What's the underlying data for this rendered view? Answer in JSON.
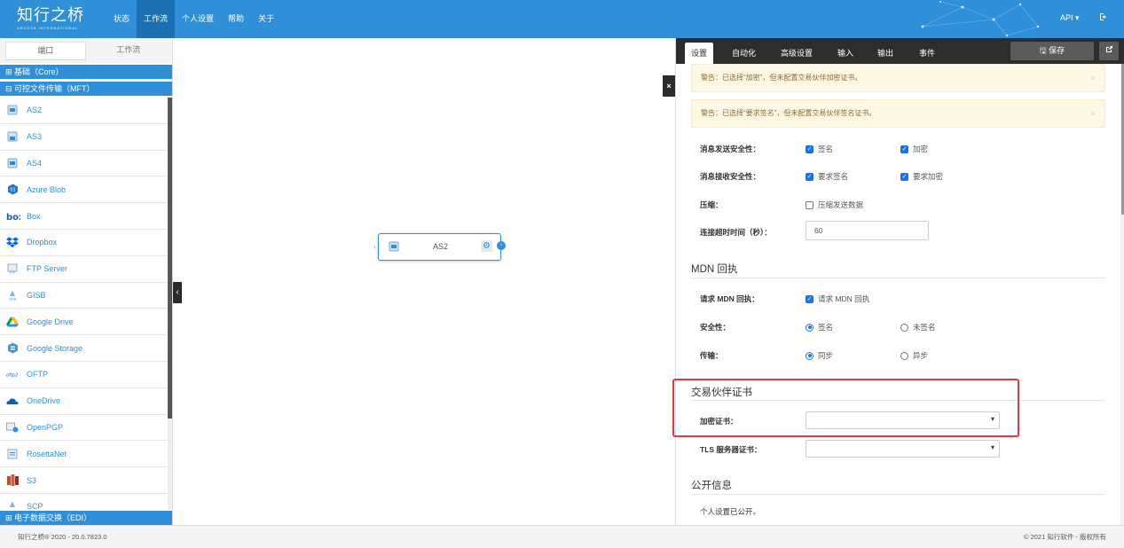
{
  "brand": {
    "name": "知行之桥",
    "subtitle": "ARCESB INTERNATIONAL"
  },
  "nav": {
    "items": [
      "状态",
      "工作流",
      "个人设置",
      "帮助",
      "关于"
    ],
    "active": "工作流",
    "api_label": "API ▾"
  },
  "sidebar": {
    "tabs": [
      "端口",
      "工作流"
    ],
    "active_tab": "端口",
    "categories": {
      "core": "⊞ 基础（Core）",
      "mft": "⊟ 可控文件传输（MFT）",
      "edi": "⊞ 电子数据交换（EDI）"
    },
    "connectors": [
      {
        "label": "AS2",
        "icon": "as2-icon"
      },
      {
        "label": "AS3",
        "icon": "as3-icon"
      },
      {
        "label": "AS4",
        "icon": "as4-icon"
      },
      {
        "label": "Azure Blob",
        "icon": "azure-blob-icon"
      },
      {
        "label": "Box",
        "icon": "box-icon"
      },
      {
        "label": "Dropbox",
        "icon": "dropbox-icon"
      },
      {
        "label": "FTP Server",
        "icon": "ftp-server-icon"
      },
      {
        "label": "GISB",
        "icon": "gisb-icon"
      },
      {
        "label": "Google Drive",
        "icon": "google-drive-icon"
      },
      {
        "label": "Google Storage",
        "icon": "google-storage-icon"
      },
      {
        "label": "OFTP",
        "icon": "oftp-icon"
      },
      {
        "label": "OneDrive",
        "icon": "onedrive-icon"
      },
      {
        "label": "OpenPGP",
        "icon": "openpgp-icon"
      },
      {
        "label": "RosettaNet",
        "icon": "rosettanet-icon"
      },
      {
        "label": "S3",
        "icon": "s3-icon"
      },
      {
        "label": "SCP",
        "icon": "scp-icon"
      }
    ]
  },
  "canvas": {
    "node_label": "AS2"
  },
  "panel": {
    "tabs": [
      "设置",
      "自动化",
      "高级设置",
      "输入",
      "输出",
      "事件"
    ],
    "active_tab": "设置",
    "save_label": "🖫 保存",
    "alerts": [
      "警告：已选择“加密”，但未配置交易伙伴加密证书。",
      "警告：已选择“要求签名”，但未配置交易伙伴签名证书。"
    ],
    "alert_close": "×",
    "send_security": {
      "label": "消息发送安全性：",
      "options": [
        {
          "text": "签名",
          "checked": true
        },
        {
          "text": "加密",
          "checked": true
        }
      ]
    },
    "receive_security": {
      "label": "消息接收安全性：",
      "options": [
        {
          "text": "要求签名",
          "checked": true
        },
        {
          "text": "要求加密",
          "checked": true
        }
      ]
    },
    "compression": {
      "label": "压缩：",
      "option": "压缩发送数据",
      "checked": false
    },
    "timeout": {
      "label": "连接超时时间（秒）：",
      "value": "60"
    },
    "mdn": {
      "title": "MDN 回执",
      "request": {
        "label": "请求 MDN 回执：",
        "option": "请求 MDN 回执",
        "checked": true
      },
      "security": {
        "label": "安全性：",
        "options": [
          "签名",
          "未签名"
        ],
        "selected": "签名"
      },
      "transport": {
        "label": "传输：",
        "options": [
          "同步",
          "异步"
        ],
        "selected": "同步"
      }
    },
    "certs": {
      "title": "交易伙伴证书",
      "encrypt_label": "加密证书：",
      "tls_label": "TLS 服务器证书："
    },
    "public": {
      "title": "公开信息",
      "text": "个人设置已公开。"
    }
  },
  "footer": {
    "left": "知行之桥® 2020 - 20.0.7823.0",
    "right": "© 2021 知行软件 - 版权所有"
  },
  "colors": {
    "primary": "#2f8fd8",
    "dark_tabs": "#2d2d2d",
    "warning_bg": "#fcf8e3",
    "highlight": "#e53935"
  }
}
